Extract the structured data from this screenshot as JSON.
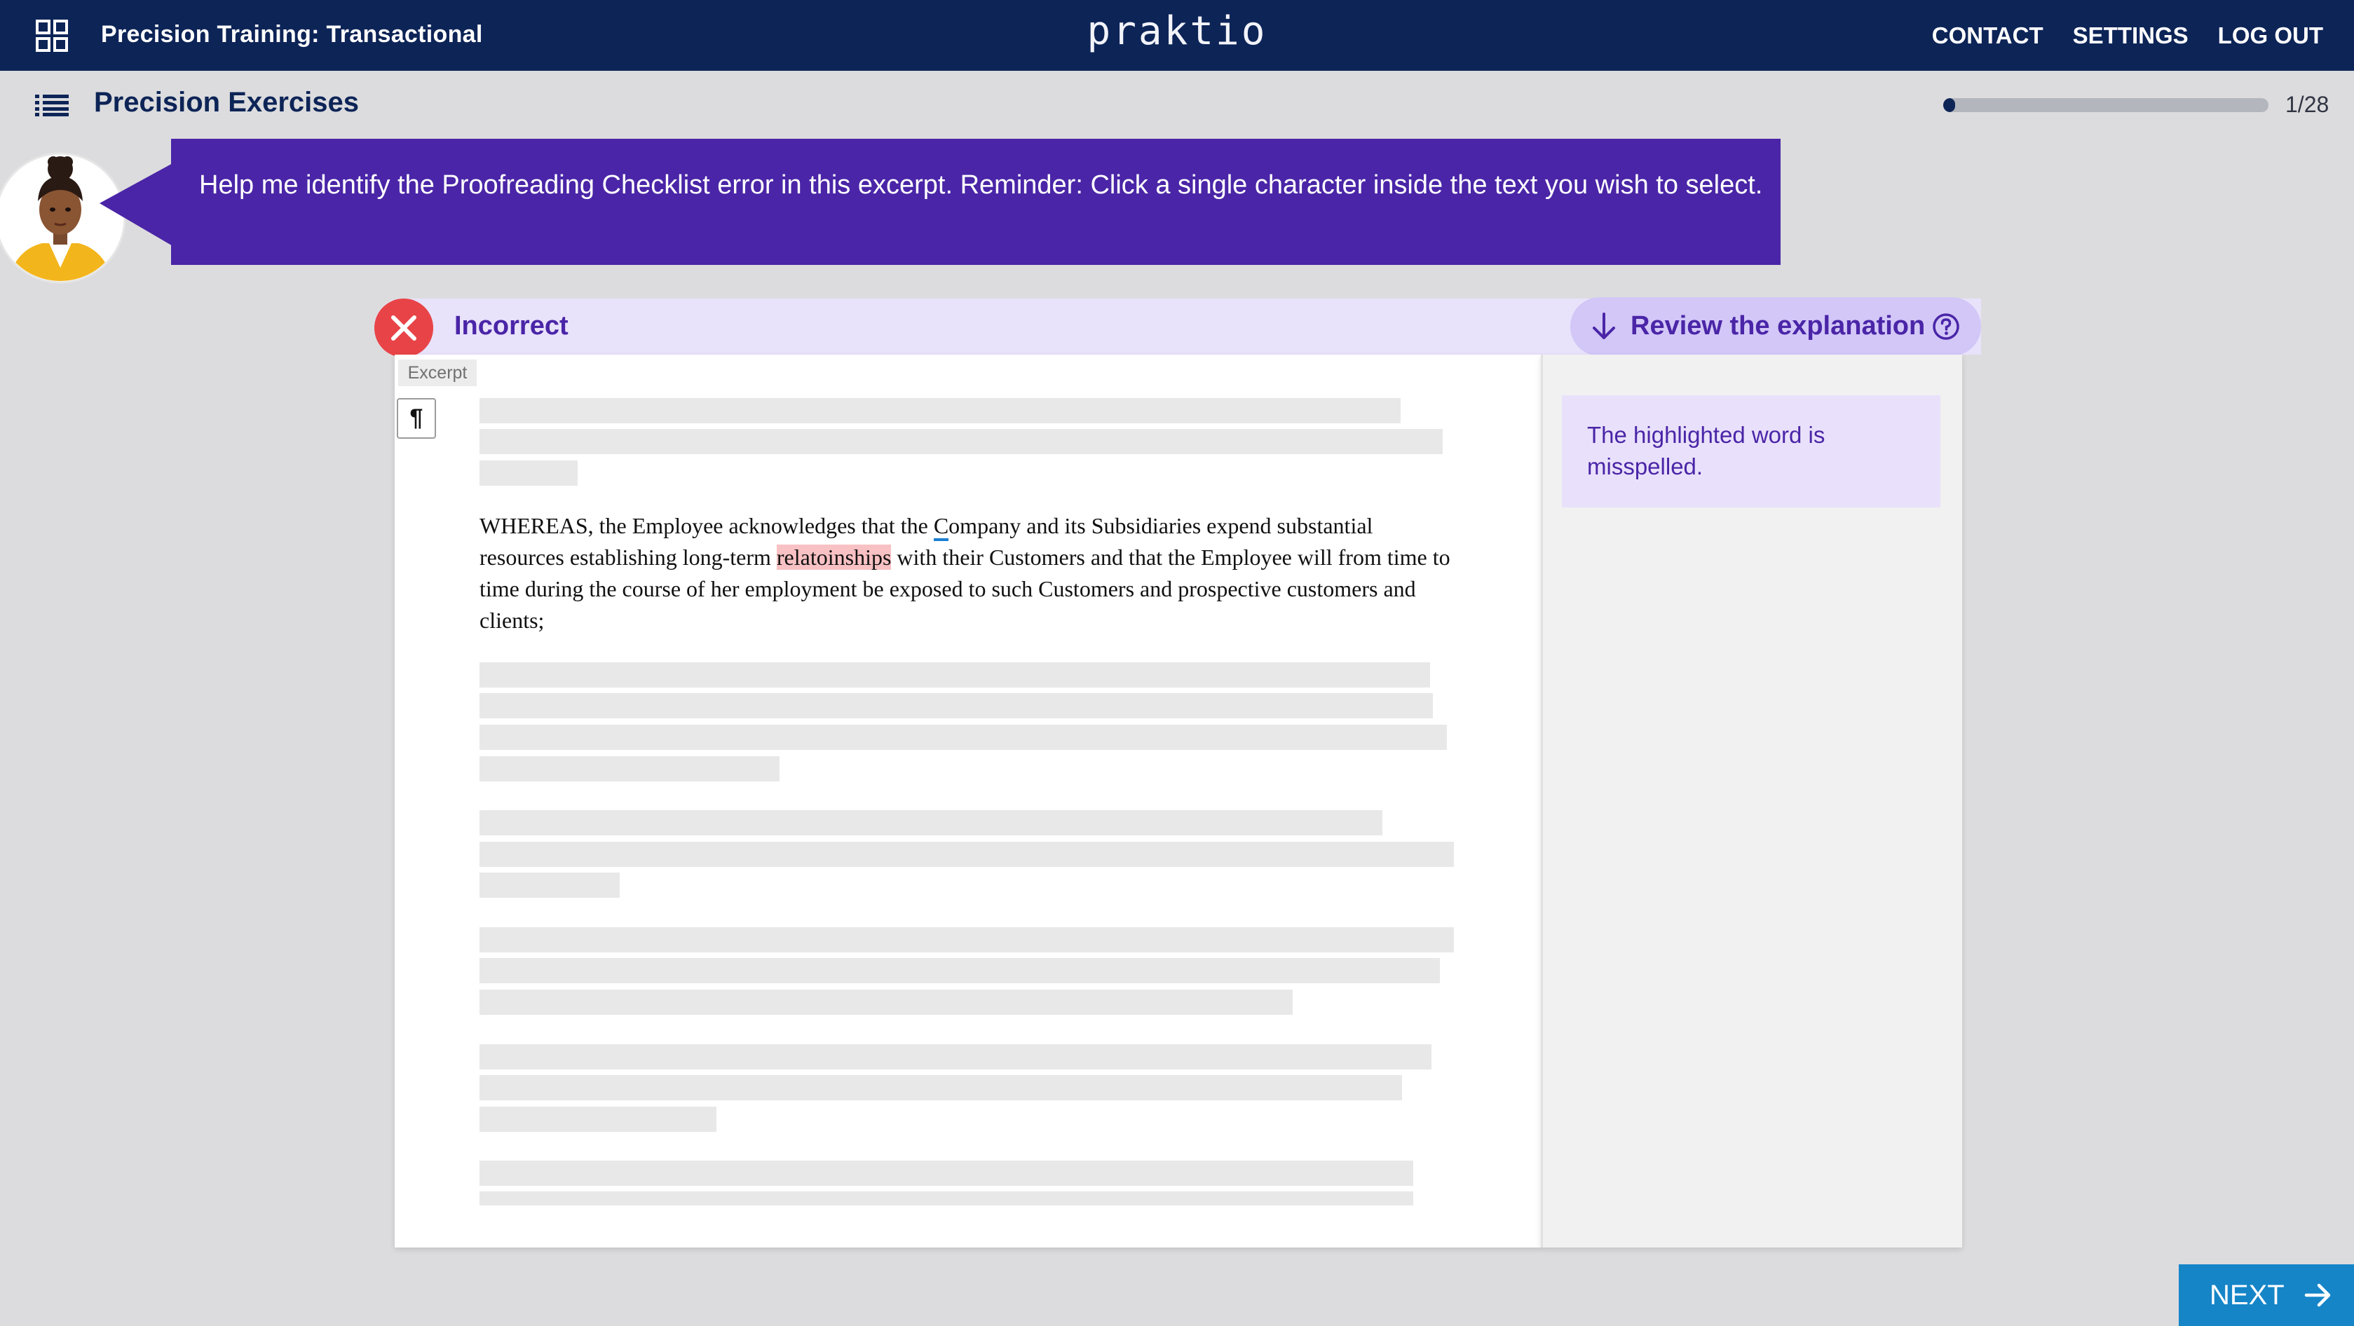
{
  "header": {
    "course_title": "Precision Training: Transactional",
    "logo": "praktio",
    "nav": [
      "CONTACT",
      "SETTINGS",
      "LOG OUT"
    ]
  },
  "subheader": {
    "title": "Precision Exercises",
    "progress_label": "1/28",
    "progress_fraction": 0.036
  },
  "prompt": {
    "text": "Help me identify the Proofreading Checklist error in this excerpt. Reminder: Click a single character inside the text you wish to select."
  },
  "result": {
    "label": "Incorrect",
    "review_label": "Review the explanation",
    "icons": {
      "status": "close-icon",
      "review": "arrow-down-icon",
      "help": "help-circle-icon"
    },
    "colors": {
      "error": "#e84448",
      "accent": "#4a25a7",
      "accent_light": "#e8e2fb"
    }
  },
  "excerpt": {
    "tab_label": "Excerpt",
    "pilcrow": "¶",
    "lines": [
      {
        "before": "WHEREAS, the Employee acknowledges that the ",
        "sel": "C",
        "after": "ompany and its Subsidiaries expend substantial"
      },
      {
        "before": "resources establishing long-term ",
        "hl": "relatoinships",
        "after": " with their Customers and that the Employee will from time to"
      },
      {
        "text": "time during the course of her employment be exposed to such Customers and prospective customers and"
      },
      {
        "text": "clients;"
      }
    ],
    "highlight_color": "#f8c1c3",
    "selection_color": "#1a7fd2"
  },
  "explanation": {
    "text": "The highlighted word is misspelled."
  },
  "footer": {
    "next_label": "NEXT",
    "next_color": "#1585c8"
  }
}
